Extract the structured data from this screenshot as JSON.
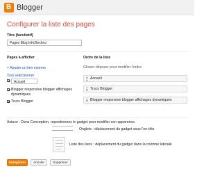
{
  "header": {
    "logo_letter": "B",
    "brand": "Blogger"
  },
  "page_title": "Configurer la liste des pages",
  "title_field": {
    "label": "Titre (facultatif)",
    "value": "Pages Blog Info2techno"
  },
  "pages": {
    "label": "Pages à afficher",
    "add_link": "+ Ajouter un lien externe",
    "select_all": "Tout sélectionner",
    "items": [
      {
        "label": "Accueil"
      },
      {
        "label": "Blogger responsive blogger affichages dynamiques"
      },
      {
        "label": "Trucs Blogger"
      }
    ]
  },
  "order": {
    "label": "Ordre de la liste",
    "hint": "Glisser-déposer pour modifier l'ordre",
    "items": [
      {
        "label": "Accueil"
      },
      {
        "label": "Trucs Blogger"
      },
      {
        "label": "Blogger responsive blogger affichages dynamiques"
      }
    ]
  },
  "tip": {
    "text": "Astuce : Dans Conception, repositionnez le gadget pour modifier son apparence.",
    "tabs_label": "Onglets : déplacement du gadget sous l'en-tête",
    "list_label": "Liste des liens : déplacement du gadget dans la colonne latérale"
  },
  "buttons": {
    "save": "Enregistrer",
    "cancel": "Annuler",
    "delete": "Supprimer"
  }
}
